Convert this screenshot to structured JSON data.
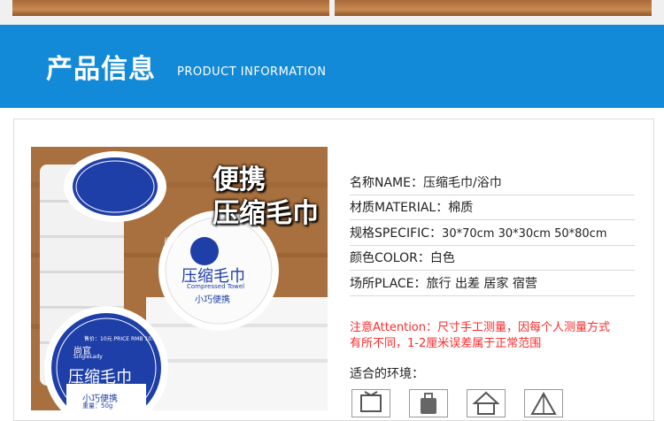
{
  "header": {
    "title_cn": "产品信息",
    "title_en": "PRODUCT INFORMATION"
  },
  "specs": [
    {
      "label": "名称NAME：",
      "value": "压缩毛巾/浴巾"
    },
    {
      "label": "材质MATERIAL：",
      "value": "棉质"
    },
    {
      "label": "规格SPECIFIC：",
      "value": "30*70cm 30*30cm 50*80cm"
    },
    {
      "label": "颜色COLOR：",
      "value": "白色"
    },
    {
      "label": "场所PLACE：",
      "value": "旅行 出差 居家 宿营"
    }
  ],
  "note": {
    "line1": "注意Attention：尺寸手工测量，因每个人测量方式",
    "line2": "有所不同，1-2厘米误差属于正常范围"
  },
  "environment": {
    "label": "适合的环境："
  },
  "product_image": {
    "headline_1": "便携",
    "headline_2": "压缩毛巾",
    "brand_cn": "尚官",
    "brand_en": "SingleLady",
    "label_cn": "压缩毛巾",
    "label_en": "Compressed Towel",
    "label_sub": "小巧便携",
    "price_text": "售价：10元  PRICE RMB 10.00",
    "weight": "重量：50g"
  },
  "colors": {
    "banner": "#138ad8",
    "note": "#ff2a2a",
    "label_blue": "#1f3fa8"
  }
}
